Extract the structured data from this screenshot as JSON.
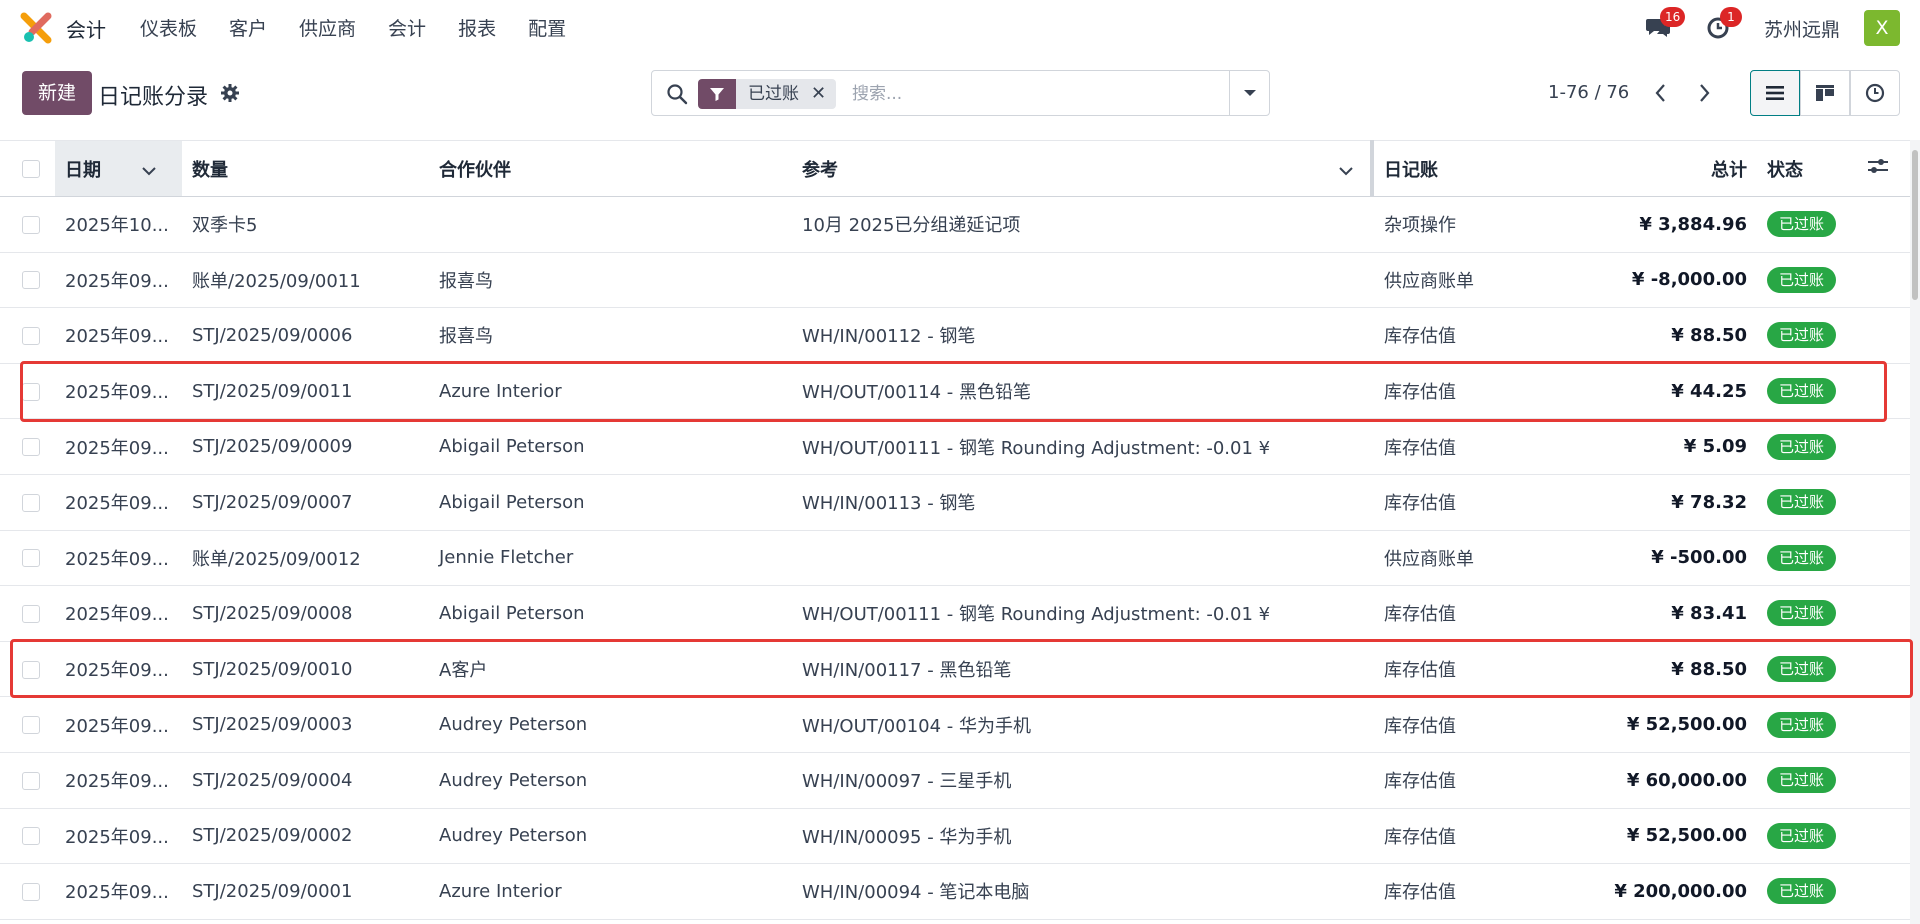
{
  "nav": {
    "app_name": "会计",
    "menu": [
      "仪表板",
      "客户",
      "供应商",
      "会计",
      "报表",
      "配置"
    ],
    "messages_count": "16",
    "activities_count": "1",
    "company": "苏州远鼎",
    "avatar_letter": "X"
  },
  "control": {
    "new_label": "新建",
    "title": "日记账分录",
    "search_facet": "已过账",
    "search_placeholder": "搜索...",
    "pager": "1-76 / 76"
  },
  "table": {
    "columns": [
      "日期",
      "数量",
      "合作伙伴",
      "参考",
      "日记账",
      "总计",
      "状态"
    ],
    "rows": [
      {
        "date": "2025年10...",
        "number": "双季卡5",
        "partner": "",
        "ref": "10月 2025已分组递延记项",
        "journal": "杂项操作",
        "total": "¥ 3,884.96",
        "status": "已过账"
      },
      {
        "date": "2025年09...",
        "number": "账单/2025/09/0011",
        "partner": "报喜鸟",
        "ref": "",
        "journal": "供应商账单",
        "total": "¥ -8,000.00",
        "status": "已过账"
      },
      {
        "date": "2025年09...",
        "number": "STJ/2025/09/0006",
        "partner": "报喜鸟",
        "ref": "WH/IN/00112 - 钢笔",
        "journal": "库存估值",
        "total": "¥ 88.50",
        "status": "已过账"
      },
      {
        "date": "2025年09...",
        "number": "STJ/2025/09/0011",
        "partner": "Azure Interior",
        "ref": "WH/OUT/00114 - 黑色铅笔",
        "journal": "库存估值",
        "total": "¥ 44.25",
        "status": "已过账"
      },
      {
        "date": "2025年09...",
        "number": "STJ/2025/09/0009",
        "partner": "Abigail Peterson",
        "ref": "WH/OUT/00111 - 钢笔 Rounding Adjustment: -0.01 ¥",
        "journal": "库存估值",
        "total": "¥ 5.09",
        "status": "已过账"
      },
      {
        "date": "2025年09...",
        "number": "STJ/2025/09/0007",
        "partner": "Abigail Peterson",
        "ref": "WH/IN/00113 - 钢笔",
        "journal": "库存估值",
        "total": "¥ 78.32",
        "status": "已过账"
      },
      {
        "date": "2025年09...",
        "number": "账单/2025/09/0012",
        "partner": "Jennie Fletcher",
        "ref": "",
        "journal": "供应商账单",
        "total": "¥ -500.00",
        "status": "已过账"
      },
      {
        "date": "2025年09...",
        "number": "STJ/2025/09/0008",
        "partner": "Abigail Peterson",
        "ref": "WH/OUT/00111 - 钢笔 Rounding Adjustment: -0.01 ¥",
        "journal": "库存估值",
        "total": "¥ 83.41",
        "status": "已过账"
      },
      {
        "date": "2025年09...",
        "number": "STJ/2025/09/0010",
        "partner": "A客户",
        "ref": "WH/IN/00117 - 黑色铅笔",
        "journal": "库存估值",
        "total": "¥ 88.50",
        "status": "已过账"
      },
      {
        "date": "2025年09...",
        "number": "STJ/2025/09/0003",
        "partner": "Audrey Peterson",
        "ref": "WH/OUT/00104 - 华为手机",
        "journal": "库存估值",
        "total": "¥ 52,500.00",
        "status": "已过账"
      },
      {
        "date": "2025年09...",
        "number": "STJ/2025/09/0004",
        "partner": "Audrey Peterson",
        "ref": "WH/IN/00097 - 三星手机",
        "journal": "库存估值",
        "total": "¥ 60,000.00",
        "status": "已过账"
      },
      {
        "date": "2025年09...",
        "number": "STJ/2025/09/0002",
        "partner": "Audrey Peterson",
        "ref": "WH/IN/00095 - 华为手机",
        "journal": "库存估值",
        "total": "¥ 52,500.00",
        "status": "已过账"
      },
      {
        "date": "2025年09...",
        "number": "STJ/2025/09/0001",
        "partner": "Azure Interior",
        "ref": "WH/IN/00094 - 笔记本电脑",
        "journal": "库存估值",
        "total": "¥ 200,000.00",
        "status": "已过账"
      }
    ]
  },
  "colors": {
    "brand": "#714b67",
    "status_green": "#28a745",
    "highlight_red": "#e53935",
    "badge_red": "#dc2626"
  }
}
